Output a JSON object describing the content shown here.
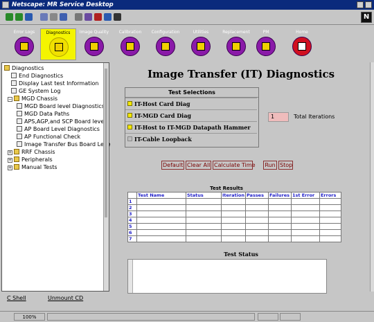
{
  "window": {
    "title": "Netscape: MR Service Desktop",
    "logo": "N"
  },
  "nav": [
    {
      "label": "Error Logs",
      "icon": "calendar-icon",
      "active": false
    },
    {
      "label": "Diagnostics",
      "icon": "stethoscope-icon",
      "active": true
    },
    {
      "label": "Image Quality",
      "icon": "image-quality-icon",
      "active": false
    },
    {
      "label": "Calibration",
      "icon": "wrench-icon",
      "active": false
    },
    {
      "label": "Configuration",
      "icon": "configuration-icon",
      "active": false
    },
    {
      "label": "Utilities",
      "icon": "toolbox-icon",
      "active": false
    },
    {
      "label": "Replacement",
      "icon": "replacement-icon",
      "active": false
    },
    {
      "label": "PM",
      "icon": "pm-clipboard-icon",
      "active": false
    },
    {
      "label": "Home",
      "icon": "home-icon",
      "active": false
    }
  ],
  "tree": {
    "items": [
      {
        "label": "Diagnostics",
        "type": "folder",
        "toggle": "−"
      },
      {
        "label": "End Diagnostics",
        "type": "doc"
      },
      {
        "label": "Display Last test Information",
        "type": "doc"
      },
      {
        "label": "GE System Log",
        "type": "doc"
      },
      {
        "label": "MGD Chassis",
        "type": "folder",
        "toggle": "−"
      },
      {
        "label": "MGD Board level Diagnostics",
        "type": "doc"
      },
      {
        "label": "MGD Data Paths",
        "type": "doc"
      },
      {
        "label": "APS,AGP,and SCP Board level",
        "type": "doc"
      },
      {
        "label": "AP Board Level Diagnostics",
        "type": "doc"
      },
      {
        "label": "AP Functional Check",
        "type": "doc"
      },
      {
        "label": "Image Transfer Bus Board Leve",
        "type": "doc"
      },
      {
        "label": "RRF Chassis",
        "type": "folder",
        "toggle": "+"
      },
      {
        "label": "Peripherals",
        "type": "folder",
        "toggle": "+"
      },
      {
        "label": "Manual Tests",
        "type": "folder",
        "toggle": "+"
      }
    ],
    "cshell_label": "C Shell",
    "unmount_label": "Unmount CD"
  },
  "main": {
    "title": "Image Transfer (IT) Diagnostics",
    "selections_header": "Test Selections",
    "selections": [
      {
        "label": "IT-Host Card Diag",
        "checked": true
      },
      {
        "label": "IT-MGD Card Diag",
        "checked": true
      },
      {
        "label": "IT-Host to IT-MGD Datapath Hammer",
        "checked": true
      },
      {
        "label": "IT-Cable Loopback",
        "checked": false
      }
    ],
    "iterations_value": "1",
    "iterations_label": "Total Iterations",
    "buttons": {
      "default": "Default",
      "clear_all": "Clear All",
      "calculate_time": "Calculate Time",
      "run": "Run",
      "stop": "Stop"
    },
    "results_title": "Test Results",
    "results_columns": [
      "Test Name",
      "Status",
      "Iteration",
      "Passes",
      "Failures",
      "1st Error",
      "Errors"
    ],
    "results_rows": [
      "1",
      "2",
      "3",
      "4",
      "5",
      "6",
      "7"
    ],
    "status_title": "Test Status"
  },
  "statusbar": {
    "zoom": "100%"
  }
}
